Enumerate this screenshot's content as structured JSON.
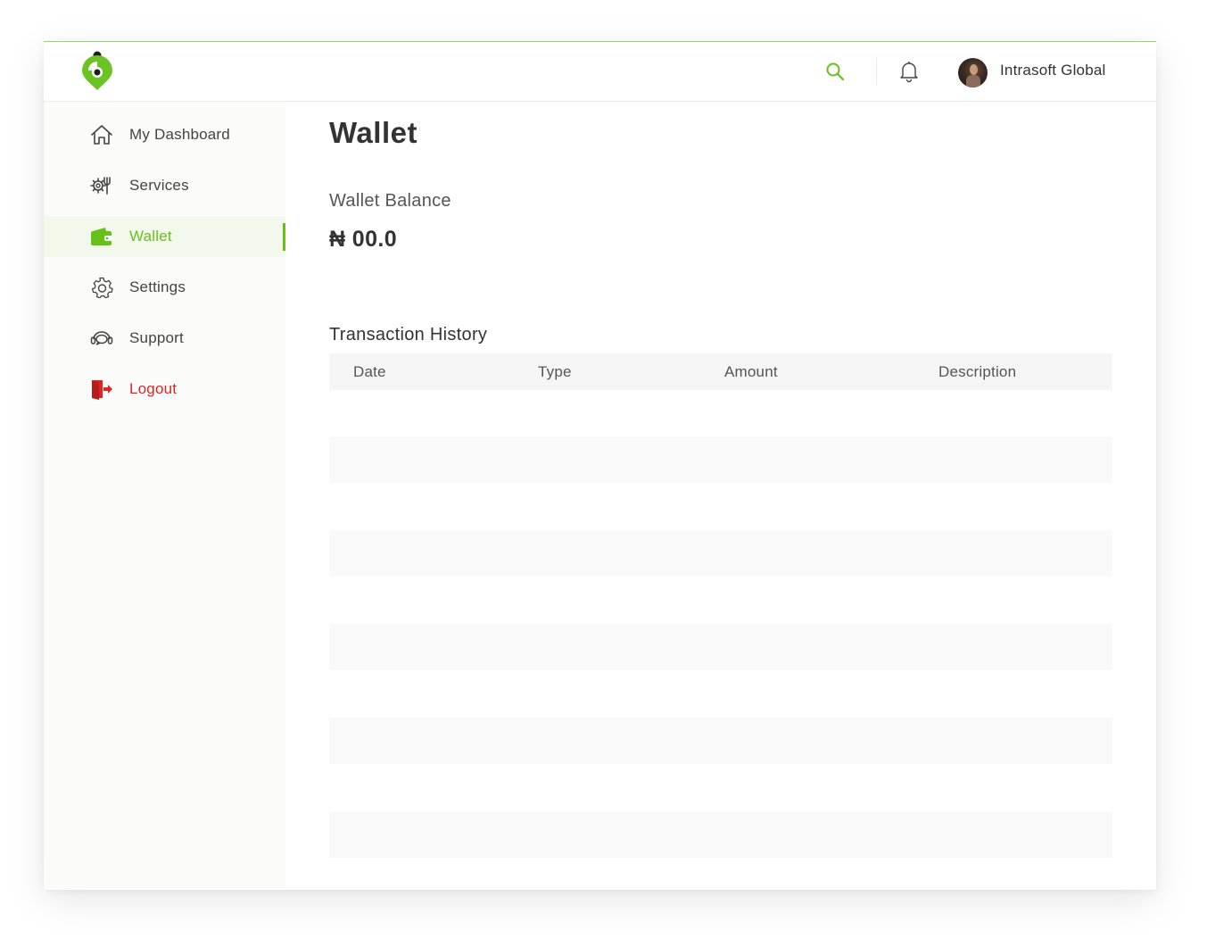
{
  "header": {
    "user_name": "Intrasoft Global",
    "icons": [
      "logo",
      "search-icon",
      "bell-icon",
      "avatar"
    ],
    "accent_color": "#66c21a"
  },
  "sidebar": {
    "items": [
      {
        "label": "My Dashboard",
        "icon": "home-icon",
        "active": false
      },
      {
        "label": "Services",
        "icon": "services-icon",
        "active": false
      },
      {
        "label": "Wallet",
        "icon": "wallet-icon",
        "active": true
      },
      {
        "label": "Settings",
        "icon": "gear-icon",
        "active": false
      },
      {
        "label": "Support",
        "icon": "support-icon",
        "active": false
      },
      {
        "label": "Logout",
        "icon": "logout-icon",
        "active": false,
        "color": "#e02424"
      }
    ]
  },
  "main": {
    "title": "Wallet",
    "balance_label": "Wallet Balance",
    "balance_amount": "₦ 00.0",
    "history_title": "Transaction History",
    "table": {
      "columns": [
        "Date",
        "Type",
        "Amount",
        "Description"
      ],
      "rows": []
    }
  }
}
